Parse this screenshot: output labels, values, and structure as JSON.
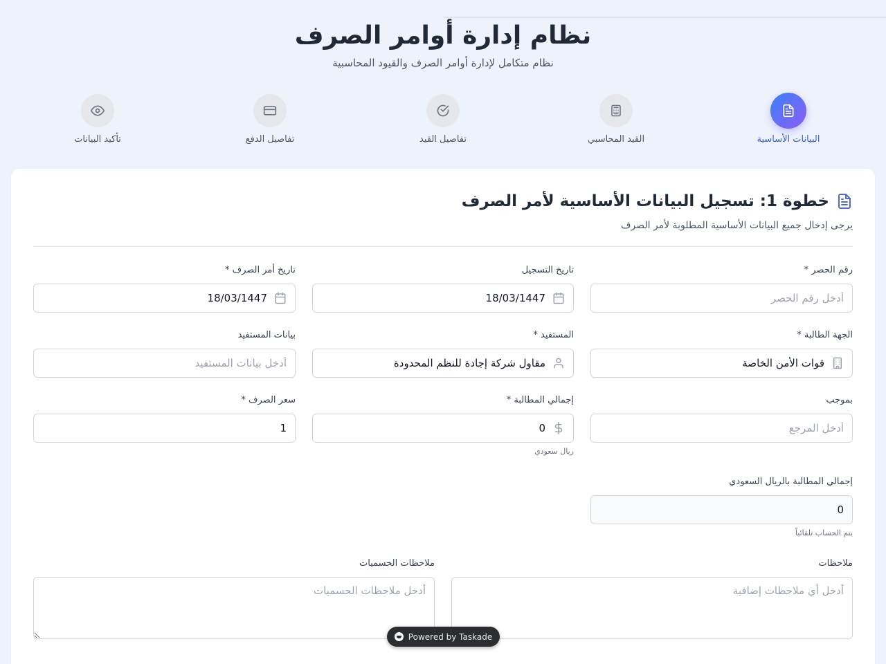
{
  "header": {
    "title": "نظام إدارة أوامر الصرف",
    "subtitle": "نظام متكامل لإدارة أوامر الصرف والقيود المحاسبية"
  },
  "steps": [
    {
      "label": "البيانات الأساسية",
      "icon": "document-icon",
      "active": true
    },
    {
      "label": "القيد المحاسبي",
      "icon": "calculator-icon",
      "active": false
    },
    {
      "label": "تفاصيل القيد",
      "icon": "check-circle-icon",
      "active": false
    },
    {
      "label": "تفاصيل الدفع",
      "icon": "credit-card-icon",
      "active": false
    },
    {
      "label": "تأكيد البيانات",
      "icon": "eye-icon",
      "active": false
    }
  ],
  "section": {
    "title": "خطوة 1: تسجيل البيانات الأساسية لأمر الصرف",
    "description": "يرجى إدخال جميع البيانات الأساسية المطلوبة لأمر الصرف"
  },
  "fields": {
    "inventory_number": {
      "label": "رقم الحصر *",
      "value": "",
      "placeholder": "أدخل رقم الحصر"
    },
    "registration_date": {
      "label": "تاريخ التسجيل",
      "value": "18/03/1447"
    },
    "order_date": {
      "label": "تاريخ أمر الصرف *",
      "value": "18/03/1447"
    },
    "requesting_entity": {
      "label": "الجهة الطالبة *",
      "value": "قوات الأمن الخاصة"
    },
    "beneficiary": {
      "label": "المستفيد *",
      "value": "مقاول شركة إجادة للنظم المحدودة"
    },
    "beneficiary_data": {
      "label": "بيانات المستفيد",
      "value": "",
      "placeholder": "أدخل بيانات المستفيد"
    },
    "reference": {
      "label": "بموجب",
      "value": "",
      "placeholder": "أدخل المرجع"
    },
    "total_claim": {
      "label": "إجمالي المطالبة *",
      "value": "0",
      "hint": "ريال سعودي"
    },
    "exchange_rate": {
      "label": "سعر الصرف *",
      "value": "1"
    },
    "total_sar": {
      "label": "إجمالي المطالبة بالريال السعودي",
      "value": "0",
      "hint": "يتم الحساب تلقائياً"
    },
    "notes": {
      "label": "ملاحظات",
      "placeholder": "أدخل أي ملاحظات إضافية"
    },
    "deduction_notes": {
      "label": "ملاحظات الحسميات",
      "placeholder": "أدخل ملاحظات الحسميات"
    }
  },
  "badge": {
    "label": "Powered by Taskade"
  },
  "colors": {
    "accent": "#3b5bd6",
    "active_gradient_start": "#3b82f6",
    "active_gradient_end": "#8b5cf6"
  }
}
